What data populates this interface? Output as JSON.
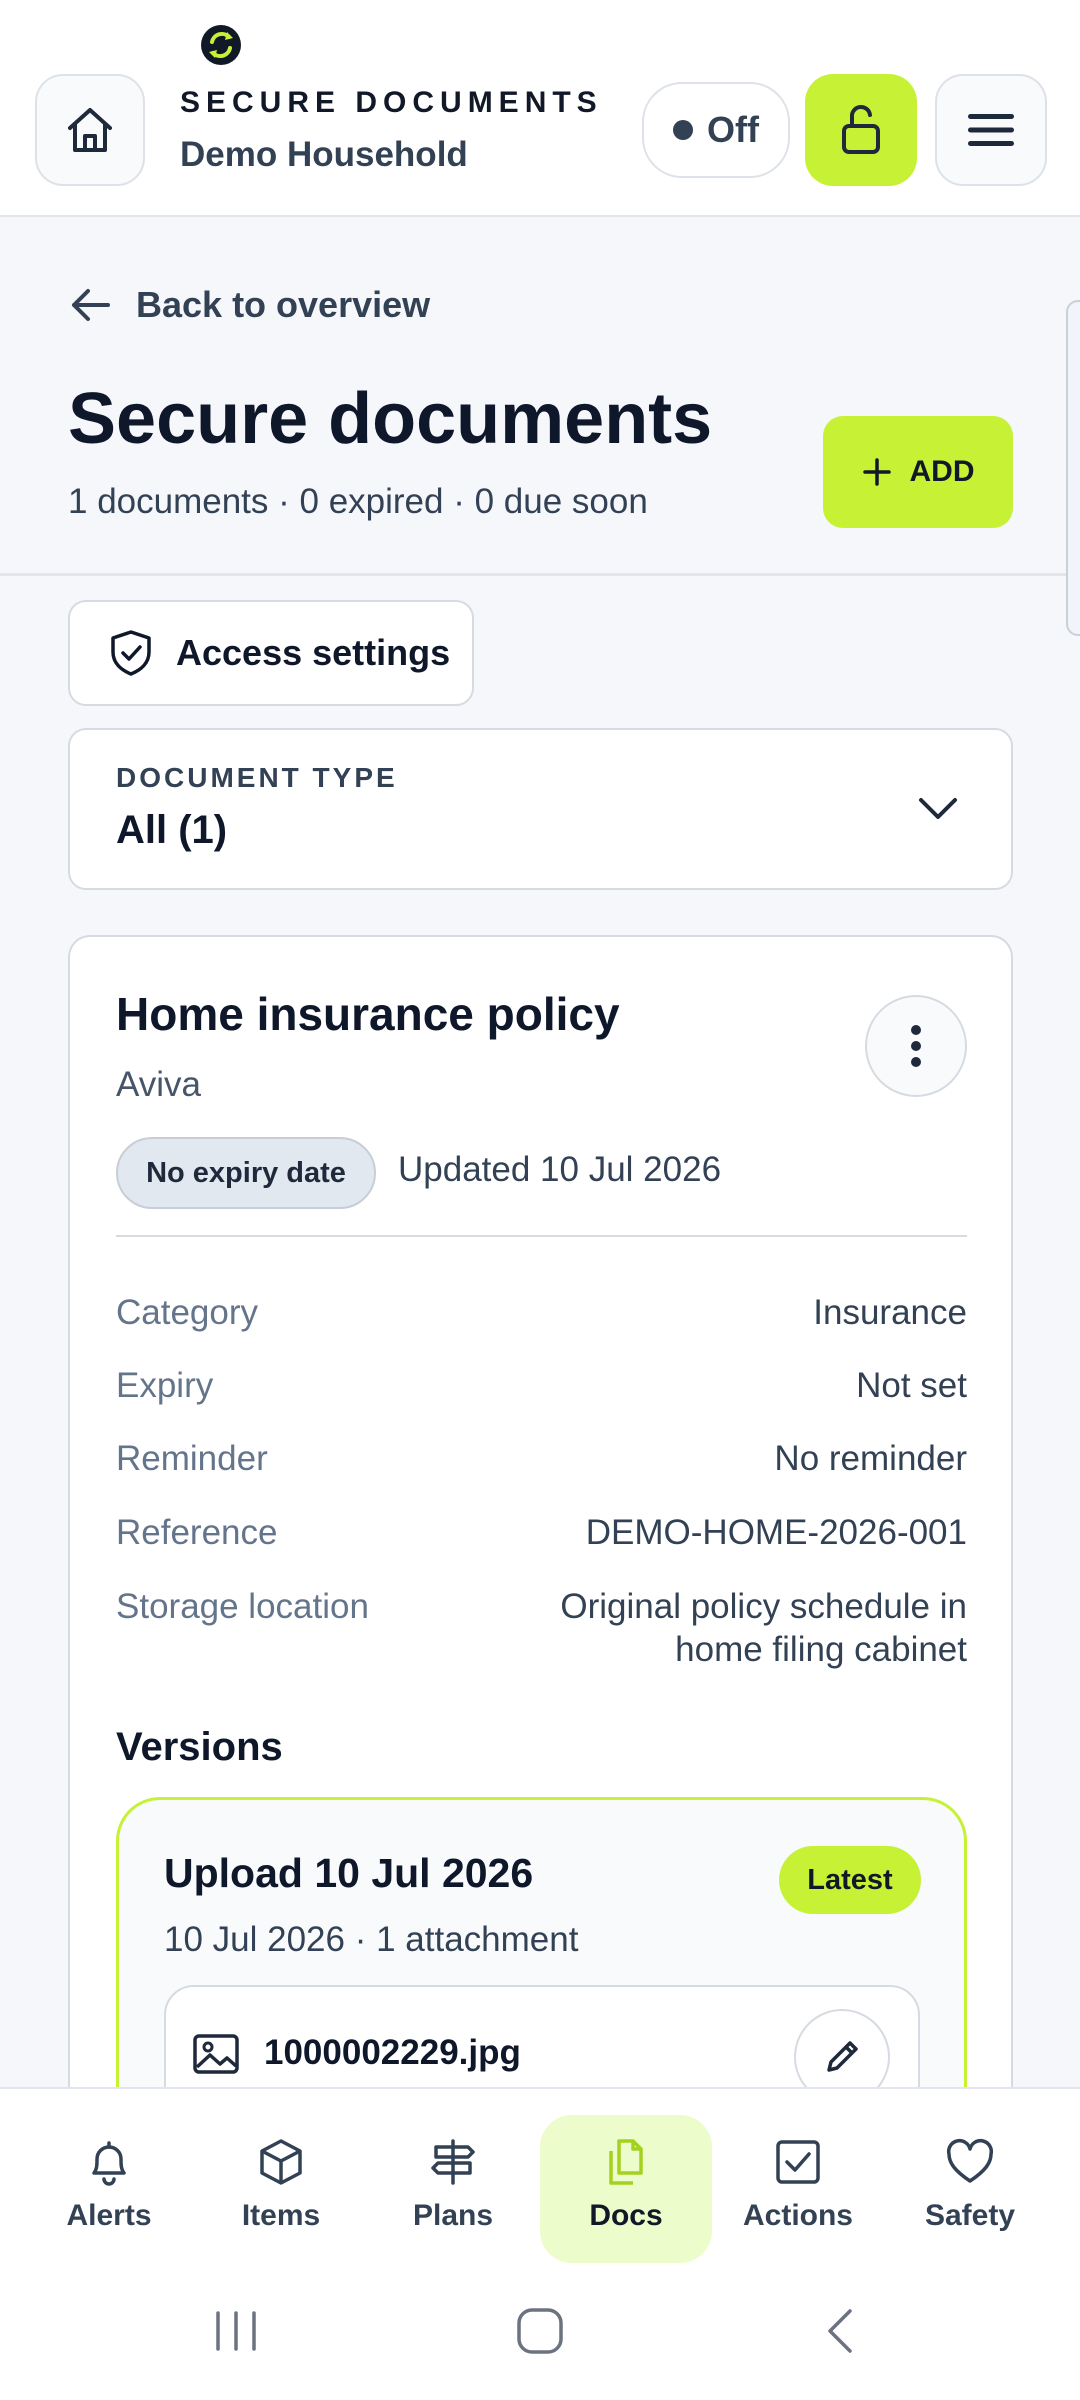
{
  "header": {
    "eyebrow": "SECURE DOCUMENTS",
    "household": "Demo Household",
    "toggle_label": "Off"
  },
  "page": {
    "back_label": "Back to overview",
    "title": "Secure documents",
    "summary": "1 documents · 0 expired · 0 due soon",
    "add_label": "ADD"
  },
  "access_settings_label": "Access settings",
  "filter": {
    "label": "DOCUMENT TYPE",
    "value": "All (1)"
  },
  "document": {
    "title": "Home insurance policy",
    "provider": "Aviva",
    "expiry_badge": "No expiry date",
    "updated": "Updated 10 Jul 2026",
    "details": [
      {
        "label": "Category",
        "value": "Insurance"
      },
      {
        "label": "Expiry",
        "value": "Not set"
      },
      {
        "label": "Reminder",
        "value": "No reminder"
      },
      {
        "label": "Reference",
        "value": "DEMO-HOME-2026-001"
      },
      {
        "label": "Storage location",
        "value_line1": "Original policy schedule in",
        "value_line2": "home filing cabinet"
      }
    ],
    "versions_heading": "Versions",
    "version": {
      "title": "Upload 10 Jul 2026",
      "badge": "Latest",
      "meta": "10 Jul 2026 · 1 attachment",
      "attachment_name": "1000002229.jpg"
    }
  },
  "nav": {
    "items": [
      {
        "label": "Alerts",
        "icon": "bell-icon"
      },
      {
        "label": "Items",
        "icon": "cube-icon"
      },
      {
        "label": "Plans",
        "icon": "signpost-icon"
      },
      {
        "label": "Docs",
        "icon": "documents-icon",
        "active": true
      },
      {
        "label": "Actions",
        "icon": "checkbox-icon"
      },
      {
        "label": "Safety",
        "icon": "heart-icon"
      }
    ]
  },
  "colors": {
    "accent": "#c6f135",
    "accent_soft": "#ecfccb",
    "text_primary": "#0f172a",
    "text_secondary": "#334155",
    "text_muted": "#64748b",
    "border": "#d6dbe2",
    "background": "#f5f7fa"
  }
}
